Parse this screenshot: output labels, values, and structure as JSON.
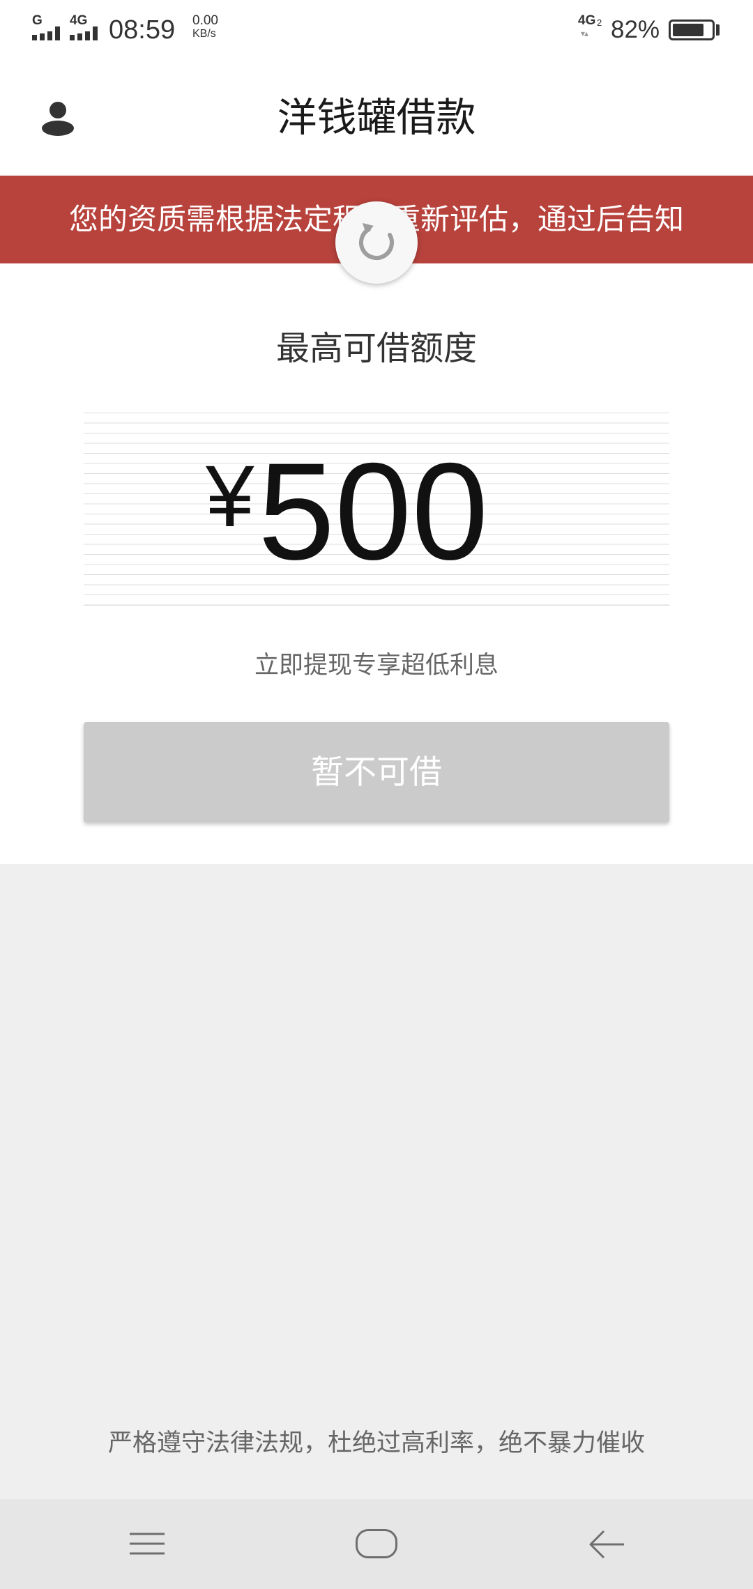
{
  "status_bar": {
    "sim1_label": "G",
    "sim2_label": "4G",
    "time": "08:59",
    "net_speed_value": "0.00",
    "net_speed_unit": "KB/s",
    "network_type": "4G",
    "network_sim": "2",
    "battery_text": "82%",
    "battery_level": 0.82,
    "icons": {
      "signal": "signal-bars-icon",
      "data_activity": "data-activity-icon",
      "battery": "battery-icon"
    }
  },
  "header": {
    "title": "洋钱罐借款",
    "profile_icon": "person-icon"
  },
  "banner": {
    "message": "您的资质需根据法定程序重新评估，通过后告知"
  },
  "loading_indicator": {
    "icon": "refresh-spinner-icon"
  },
  "credit": {
    "label": "最高可借额度",
    "currency_symbol": "¥",
    "amount": "500",
    "subtitle": "立即提现专享超低利息"
  },
  "action": {
    "button_label": "暂不可借",
    "disabled": true
  },
  "footer": {
    "notice": "严格遵守法律法规，杜绝过高利率，绝不暴力催收"
  },
  "nav_bar": {
    "icons": [
      "menu-icon",
      "home-icon",
      "back-icon"
    ]
  },
  "colors": {
    "banner": "#b8423c",
    "button_disabled": "#cbcbcb",
    "page_background": "#efeff0",
    "nav_background": "#e6e6e6"
  }
}
